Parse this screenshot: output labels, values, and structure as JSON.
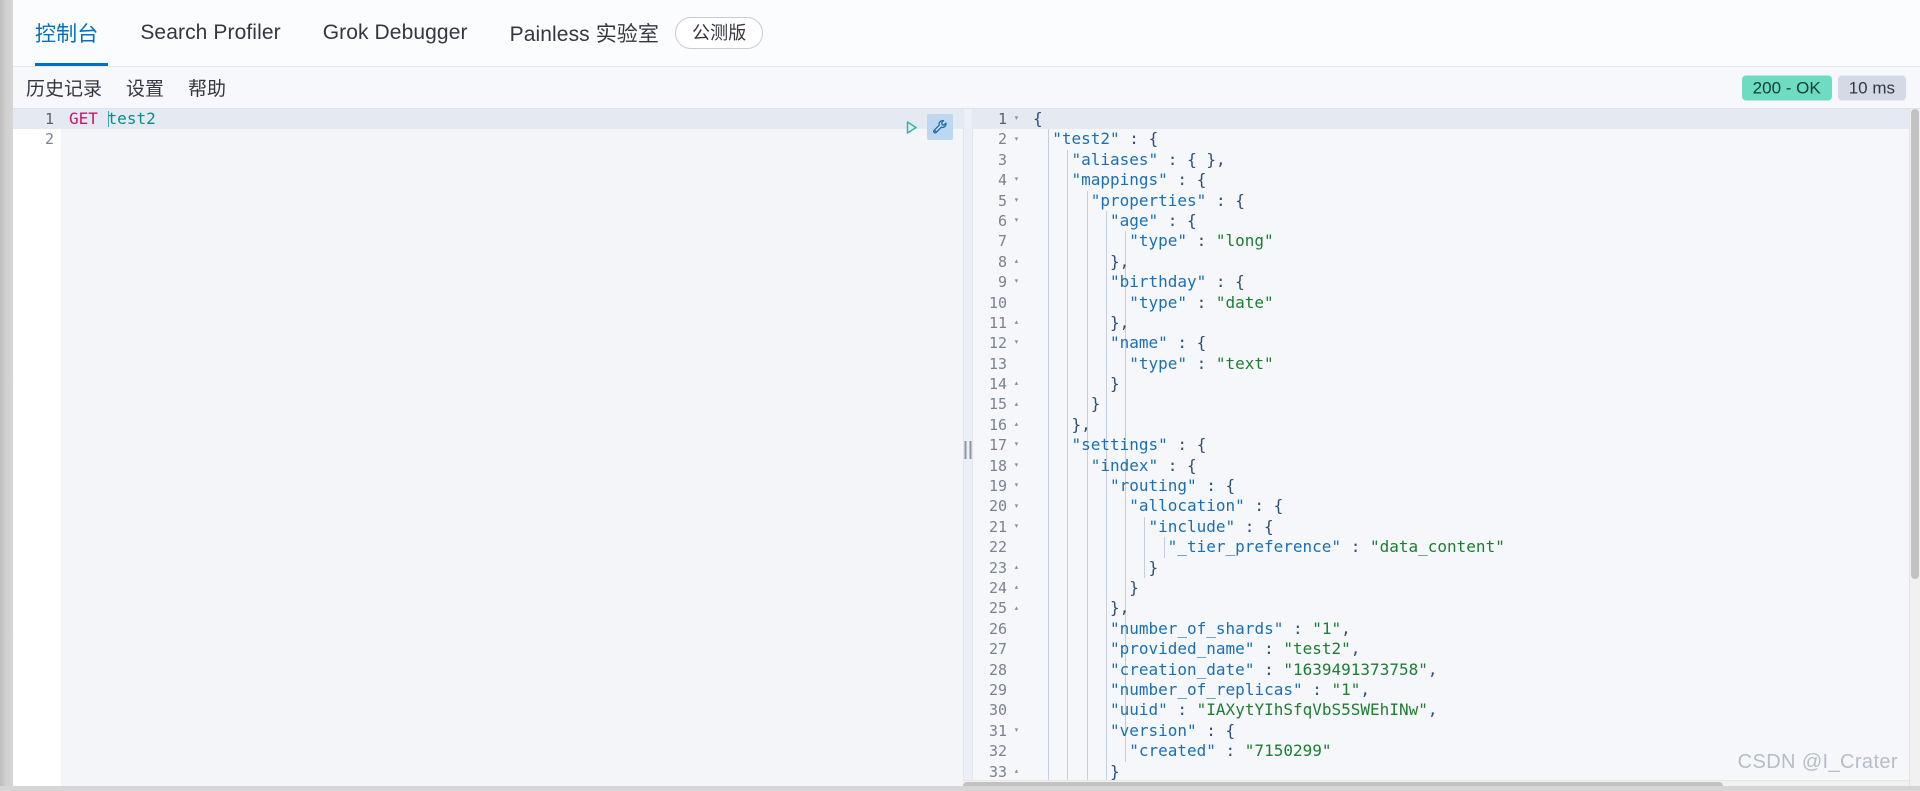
{
  "window": {
    "watermark": "CSDN @I_Crater"
  },
  "top_tabs": [
    {
      "label": "控制台",
      "active": true,
      "badge": null
    },
    {
      "label": "Search Profiler",
      "active": false,
      "badge": null
    },
    {
      "label": "Grok Debugger",
      "active": false,
      "badge": null
    },
    {
      "label": "Painless 实验室",
      "active": false,
      "badge": "公测版"
    }
  ],
  "subnav": {
    "items": [
      {
        "label": "历史记录"
      },
      {
        "label": "设置"
      },
      {
        "label": "帮助"
      }
    ],
    "status": {
      "code": "200 - OK",
      "code_color": "#6ddcc0",
      "time": "10 ms",
      "time_color": "#d3dae6"
    }
  },
  "editor": {
    "icons": {
      "play": "play-icon",
      "wrench": "wrench-icon"
    },
    "gutter": [
      {
        "n": "1",
        "highlight": true
      },
      {
        "n": "2",
        "highlight": false
      }
    ],
    "lines": [
      {
        "highlight": true,
        "method": "GET",
        "path": "test2",
        "caret": true
      },
      {
        "highlight": false,
        "method": "",
        "path": "",
        "caret": false
      }
    ]
  },
  "output": {
    "gutter": [
      {
        "n": "1",
        "fold": "▾",
        "highlight": true
      },
      {
        "n": "2",
        "fold": "▾",
        "highlight": false
      },
      {
        "n": "3",
        "fold": "",
        "highlight": false
      },
      {
        "n": "4",
        "fold": "▾",
        "highlight": false
      },
      {
        "n": "5",
        "fold": "▾",
        "highlight": false
      },
      {
        "n": "6",
        "fold": "▾",
        "highlight": false
      },
      {
        "n": "7",
        "fold": "",
        "highlight": false
      },
      {
        "n": "8",
        "fold": "▴",
        "highlight": false
      },
      {
        "n": "9",
        "fold": "▾",
        "highlight": false
      },
      {
        "n": "10",
        "fold": "",
        "highlight": false
      },
      {
        "n": "11",
        "fold": "▴",
        "highlight": false
      },
      {
        "n": "12",
        "fold": "▾",
        "highlight": false
      },
      {
        "n": "13",
        "fold": "",
        "highlight": false
      },
      {
        "n": "14",
        "fold": "▴",
        "highlight": false
      },
      {
        "n": "15",
        "fold": "▴",
        "highlight": false
      },
      {
        "n": "16",
        "fold": "▴",
        "highlight": false
      },
      {
        "n": "17",
        "fold": "▾",
        "highlight": false
      },
      {
        "n": "18",
        "fold": "▾",
        "highlight": false
      },
      {
        "n": "19",
        "fold": "▾",
        "highlight": false
      },
      {
        "n": "20",
        "fold": "▾",
        "highlight": false
      },
      {
        "n": "21",
        "fold": "▾",
        "highlight": false
      },
      {
        "n": "22",
        "fold": "",
        "highlight": false
      },
      {
        "n": "23",
        "fold": "▴",
        "highlight": false
      },
      {
        "n": "24",
        "fold": "▴",
        "highlight": false
      },
      {
        "n": "25",
        "fold": "▴",
        "highlight": false
      },
      {
        "n": "26",
        "fold": "",
        "highlight": false
      },
      {
        "n": "27",
        "fold": "",
        "highlight": false
      },
      {
        "n": "28",
        "fold": "",
        "highlight": false
      },
      {
        "n": "29",
        "fold": "",
        "highlight": false
      },
      {
        "n": "30",
        "fold": "",
        "highlight": false
      },
      {
        "n": "31",
        "fold": "▾",
        "highlight": false
      },
      {
        "n": "32",
        "fold": "",
        "highlight": false
      },
      {
        "n": "33",
        "fold": "▴",
        "highlight": false
      }
    ],
    "json_text": "{\n  \"test2\" : {\n    \"aliases\" : { },\n    \"mappings\" : {\n      \"properties\" : {\n        \"age\" : {\n          \"type\" : \"long\"\n        },\n        \"birthday\" : {\n          \"type\" : \"date\"\n        },\n        \"name\" : {\n          \"type\" : \"text\"\n        }\n      }\n    },\n    \"settings\" : {\n      \"index\" : {\n        \"routing\" : {\n          \"allocation\" : {\n            \"include\" : {\n              \"_tier_preference\" : \"data_content\"\n            }\n          }\n        },\n        \"number_of_shards\" : \"1\",\n        \"provided_name\" : \"test2\",\n        \"creation_date\" : \"1639491373758\",\n        \"number_of_replicas\" : \"1\",\n        \"uuid\" : \"IAXytYIhSfqVbS5SWEhINw\",\n        \"version\" : {\n          \"created\" : \"7150299\"\n        }",
    "lines": [
      {
        "indent": 0,
        "highlight": true,
        "tokens": [
          {
            "t": "punc",
            "v": "{"
          }
        ]
      },
      {
        "indent": 1,
        "highlight": false,
        "tokens": [
          {
            "t": "key",
            "v": "\"test2\""
          },
          {
            "t": "punc",
            "v": " : {"
          }
        ]
      },
      {
        "indent": 2,
        "highlight": false,
        "tokens": [
          {
            "t": "key",
            "v": "\"aliases\""
          },
          {
            "t": "punc",
            "v": " : { },"
          }
        ]
      },
      {
        "indent": 2,
        "highlight": false,
        "tokens": [
          {
            "t": "key",
            "v": "\"mappings\""
          },
          {
            "t": "punc",
            "v": " : {"
          }
        ]
      },
      {
        "indent": 3,
        "highlight": false,
        "tokens": [
          {
            "t": "key",
            "v": "\"properties\""
          },
          {
            "t": "punc",
            "v": " : {"
          }
        ]
      },
      {
        "indent": 4,
        "highlight": false,
        "tokens": [
          {
            "t": "key",
            "v": "\"age\""
          },
          {
            "t": "punc",
            "v": " : {"
          }
        ]
      },
      {
        "indent": 5,
        "highlight": false,
        "tokens": [
          {
            "t": "key",
            "v": "\"type\""
          },
          {
            "t": "punc",
            "v": " : "
          },
          {
            "t": "str",
            "v": "\"long\""
          }
        ]
      },
      {
        "indent": 4,
        "highlight": false,
        "tokens": [
          {
            "t": "punc",
            "v": "},"
          }
        ]
      },
      {
        "indent": 4,
        "highlight": false,
        "tokens": [
          {
            "t": "key",
            "v": "\"birthday\""
          },
          {
            "t": "punc",
            "v": " : {"
          }
        ]
      },
      {
        "indent": 5,
        "highlight": false,
        "tokens": [
          {
            "t": "key",
            "v": "\"type\""
          },
          {
            "t": "punc",
            "v": " : "
          },
          {
            "t": "str",
            "v": "\"date\""
          }
        ]
      },
      {
        "indent": 4,
        "highlight": false,
        "tokens": [
          {
            "t": "punc",
            "v": "},"
          }
        ]
      },
      {
        "indent": 4,
        "highlight": false,
        "tokens": [
          {
            "t": "key",
            "v": "\"name\""
          },
          {
            "t": "punc",
            "v": " : {"
          }
        ]
      },
      {
        "indent": 5,
        "highlight": false,
        "tokens": [
          {
            "t": "key",
            "v": "\"type\""
          },
          {
            "t": "punc",
            "v": " : "
          },
          {
            "t": "str",
            "v": "\"text\""
          }
        ]
      },
      {
        "indent": 4,
        "highlight": false,
        "tokens": [
          {
            "t": "punc",
            "v": "}"
          }
        ]
      },
      {
        "indent": 3,
        "highlight": false,
        "tokens": [
          {
            "t": "punc",
            "v": "}"
          }
        ]
      },
      {
        "indent": 2,
        "highlight": false,
        "tokens": [
          {
            "t": "punc",
            "v": "},"
          }
        ]
      },
      {
        "indent": 2,
        "highlight": false,
        "tokens": [
          {
            "t": "key",
            "v": "\"settings\""
          },
          {
            "t": "punc",
            "v": " : {"
          }
        ]
      },
      {
        "indent": 3,
        "highlight": false,
        "tokens": [
          {
            "t": "key",
            "v": "\"index\""
          },
          {
            "t": "punc",
            "v": " : {"
          }
        ]
      },
      {
        "indent": 4,
        "highlight": false,
        "tokens": [
          {
            "t": "key",
            "v": "\"routing\""
          },
          {
            "t": "punc",
            "v": " : {"
          }
        ]
      },
      {
        "indent": 5,
        "highlight": false,
        "tokens": [
          {
            "t": "key",
            "v": "\"allocation\""
          },
          {
            "t": "punc",
            "v": " : {"
          }
        ]
      },
      {
        "indent": 6,
        "highlight": false,
        "tokens": [
          {
            "t": "key",
            "v": "\"include\""
          },
          {
            "t": "punc",
            "v": " : {"
          }
        ]
      },
      {
        "indent": 7,
        "highlight": false,
        "tokens": [
          {
            "t": "key",
            "v": "\"_tier_preference\""
          },
          {
            "t": "punc",
            "v": " : "
          },
          {
            "t": "str",
            "v": "\"data_content\""
          }
        ]
      },
      {
        "indent": 6,
        "highlight": false,
        "tokens": [
          {
            "t": "punc",
            "v": "}"
          }
        ]
      },
      {
        "indent": 5,
        "highlight": false,
        "tokens": [
          {
            "t": "punc",
            "v": "}"
          }
        ]
      },
      {
        "indent": 4,
        "highlight": false,
        "tokens": [
          {
            "t": "punc",
            "v": "},"
          }
        ]
      },
      {
        "indent": 4,
        "highlight": false,
        "tokens": [
          {
            "t": "key",
            "v": "\"number_of_shards\""
          },
          {
            "t": "punc",
            "v": " : "
          },
          {
            "t": "str",
            "v": "\"1\""
          },
          {
            "t": "punc",
            "v": ","
          }
        ]
      },
      {
        "indent": 4,
        "highlight": false,
        "tokens": [
          {
            "t": "key",
            "v": "\"provided_name\""
          },
          {
            "t": "punc",
            "v": " : "
          },
          {
            "t": "str",
            "v": "\"test2\""
          },
          {
            "t": "punc",
            "v": ","
          }
        ]
      },
      {
        "indent": 4,
        "highlight": false,
        "tokens": [
          {
            "t": "key",
            "v": "\"creation_date\""
          },
          {
            "t": "punc",
            "v": " : "
          },
          {
            "t": "str",
            "v": "\"1639491373758\""
          },
          {
            "t": "punc",
            "v": ","
          }
        ]
      },
      {
        "indent": 4,
        "highlight": false,
        "tokens": [
          {
            "t": "key",
            "v": "\"number_of_replicas\""
          },
          {
            "t": "punc",
            "v": " : "
          },
          {
            "t": "str",
            "v": "\"1\""
          },
          {
            "t": "punc",
            "v": ","
          }
        ]
      },
      {
        "indent": 4,
        "highlight": false,
        "tokens": [
          {
            "t": "key",
            "v": "\"uuid\""
          },
          {
            "t": "punc",
            "v": " : "
          },
          {
            "t": "str",
            "v": "\"IAXytYIhSfqVbS5SWEhINw\""
          },
          {
            "t": "punc",
            "v": ","
          }
        ]
      },
      {
        "indent": 4,
        "highlight": false,
        "tokens": [
          {
            "t": "key",
            "v": "\"version\""
          },
          {
            "t": "punc",
            "v": " : {"
          }
        ]
      },
      {
        "indent": 5,
        "highlight": false,
        "tokens": [
          {
            "t": "key",
            "v": "\"created\""
          },
          {
            "t": "punc",
            "v": " : "
          },
          {
            "t": "str",
            "v": "\"7150299\""
          }
        ]
      },
      {
        "indent": 4,
        "highlight": false,
        "tokens": [
          {
            "t": "punc",
            "v": "}"
          }
        ]
      }
    ]
  }
}
